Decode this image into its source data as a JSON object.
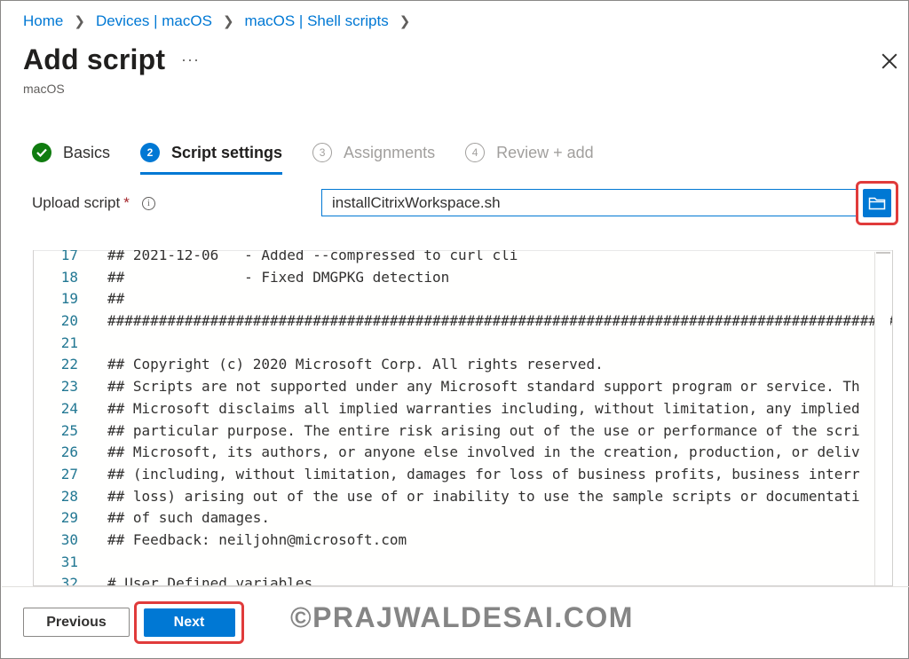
{
  "breadcrumb": [
    "Home",
    "Devices | macOS",
    "macOS | Shell scripts"
  ],
  "header": {
    "title": "Add script",
    "more_label": "···",
    "subtitle": "macOS"
  },
  "steps": [
    {
      "number": "",
      "label": "Basics",
      "state": "done"
    },
    {
      "number": "2",
      "label": "Script settings",
      "state": "active"
    },
    {
      "number": "3",
      "label": "Assignments",
      "state": "todo"
    },
    {
      "number": "4",
      "label": "Review + add",
      "state": "todo"
    }
  ],
  "upload": {
    "label": "Upload script",
    "required_mark": "*",
    "info_glyph": "i",
    "value": "installCitrixWorkspace.sh"
  },
  "code": {
    "lines": [
      {
        "n": "17",
        "text": "## 2021-12-06   - Added --compressed to curl cli"
      },
      {
        "n": "18",
        "text": "##              - Fixed DMGPKG detection"
      },
      {
        "n": "19",
        "text": "##"
      },
      {
        "n": "20",
        "text": "##############################################################################################"
      },
      {
        "n": "21",
        "text": ""
      },
      {
        "n": "22",
        "text": "## Copyright (c) 2020 Microsoft Corp. All rights reserved."
      },
      {
        "n": "23",
        "text": "## Scripts are not supported under any Microsoft standard support program or service. Th"
      },
      {
        "n": "24",
        "text": "## Microsoft disclaims all implied warranties including, without limitation, any implied"
      },
      {
        "n": "25",
        "text": "## particular purpose. The entire risk arising out of the use or performance of the scri"
      },
      {
        "n": "26",
        "text": "## Microsoft, its authors, or anyone else involved in the creation, production, or deliv"
      },
      {
        "n": "27",
        "text": "## (including, without limitation, damages for loss of business profits, business interr"
      },
      {
        "n": "28",
        "text": "## loss) arising out of the use of or inability to use the sample scripts or documentati"
      },
      {
        "n": "29",
        "text": "## of such damages."
      },
      {
        "n": "30",
        "text": "## Feedback: neiljohn@microsoft.com"
      },
      {
        "n": "31",
        "text": ""
      },
      {
        "n": "32",
        "text": "# User Defined variables"
      }
    ]
  },
  "footer": {
    "previous_label": "Previous",
    "next_label": "Next",
    "watermark": "©PRAJWALDESAI.COM"
  },
  "colors": {
    "accent": "#0078d4",
    "success": "#107c10",
    "highlight": "#e03b3b"
  }
}
